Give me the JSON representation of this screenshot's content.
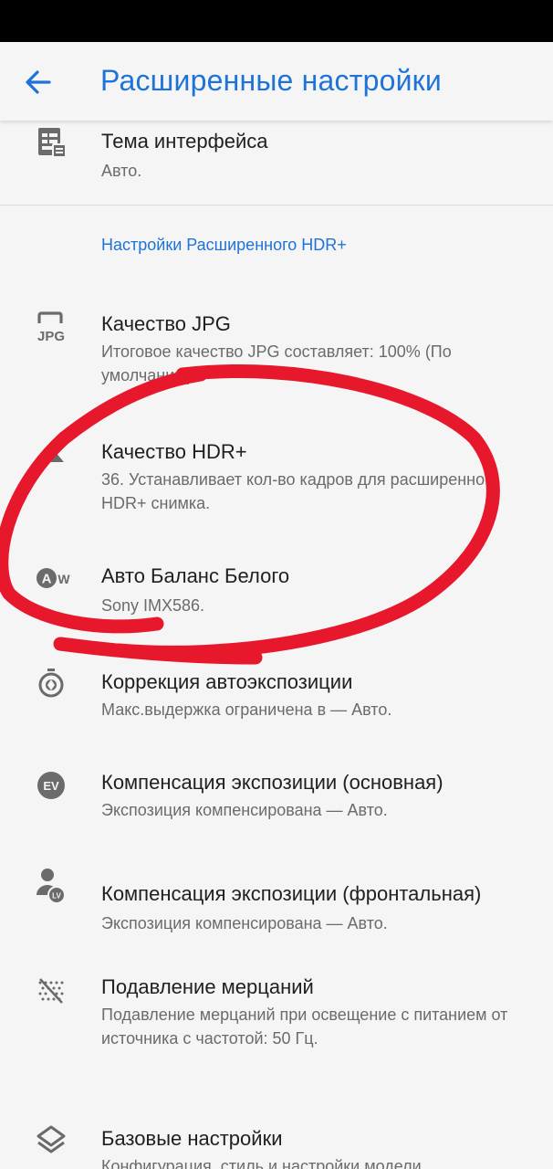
{
  "app_bar": {
    "title": "Расширенные настройки"
  },
  "category": {
    "title": "Настройки Расширенного HDR+"
  },
  "prefs": {
    "theme": {
      "title": "Тема интерфейса",
      "summary": "Авто."
    },
    "jpg": {
      "title": "Качество JPG",
      "summary": "Итоговое качество JPG составляет: 100% (По умолчанию)",
      "icon_text": "JPG"
    },
    "hdr": {
      "title": "Качество HDR+",
      "summary": "36. Устанавливает кол-во кадров для расширенного HDR+ снимка."
    },
    "awb": {
      "title": "Авто Баланс Белого",
      "summary": "Sony IMX586.",
      "icon_text": "A",
      "icon_sub": "W"
    },
    "ae": {
      "title": "Коррекция автоэкспозиции",
      "summary": "Макс.выдержка ограничена в — Авто."
    },
    "ev_main": {
      "title": "Компенсация экспозиции (основная)",
      "summary": "Экспозиция компенсирована — Авто.",
      "icon_text": "EV"
    },
    "ev_front": {
      "title": "Компенсация экспозиции (фронтальная)",
      "summary": "Экспозиция компенсирована — Авто.",
      "icon_text": "LV"
    },
    "flicker": {
      "title": "Подавление мерцаний",
      "summary": "Подавление мерцаний при освещение с питанием от источника с частотой: 50 Гц."
    },
    "base": {
      "title": "Базовые настройки",
      "summary": "Конфигурация, стиль и настройки модели"
    }
  },
  "colors": {
    "accent": "#1e73d8",
    "annotation_red": "#e8182c",
    "icon_gray": "#6b6b6b"
  }
}
